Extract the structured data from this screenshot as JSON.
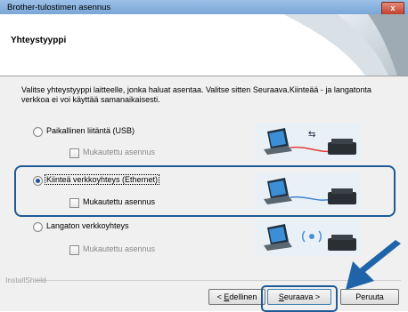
{
  "window": {
    "title": "Brother-tulostimen asennus",
    "close_label": "x"
  },
  "header": {
    "title": "Yhteystyyppi"
  },
  "intro_text": "Valitse yhteystyyppi laitteelle, jonka haluat asentaa. Valitse sitten Seuraava.Kiinteää - ja langatonta verkkoa ei voi käyttää samanaikaisesti.",
  "options": [
    {
      "label": "Paikallinen liitäntä (USB)",
      "selected": false,
      "custom_label": "Mukautettu asennus",
      "custom_enabled": false,
      "icon": "usb-connection-icon"
    },
    {
      "label": "Kiinteä verkkoyhteys (Ethernet)",
      "selected": true,
      "custom_label": "Mukautettu asennus",
      "custom_enabled": true,
      "icon": "ethernet-connection-icon"
    },
    {
      "label": "Langaton verkkoyhteys",
      "selected": false,
      "custom_label": "Mukautettu asennus",
      "custom_enabled": false,
      "icon": "wireless-connection-icon"
    }
  ],
  "footer": {
    "installshield": "InstallShield",
    "back_label": "< Edellinen",
    "back_hotkey": "E",
    "back_rest": "dellinen",
    "next_hotkey": "S",
    "next_rest": "euraava >",
    "cancel_label": "Peruuta"
  },
  "colors": {
    "highlight": "#1f5a96",
    "arrow": "#1f63a8"
  }
}
